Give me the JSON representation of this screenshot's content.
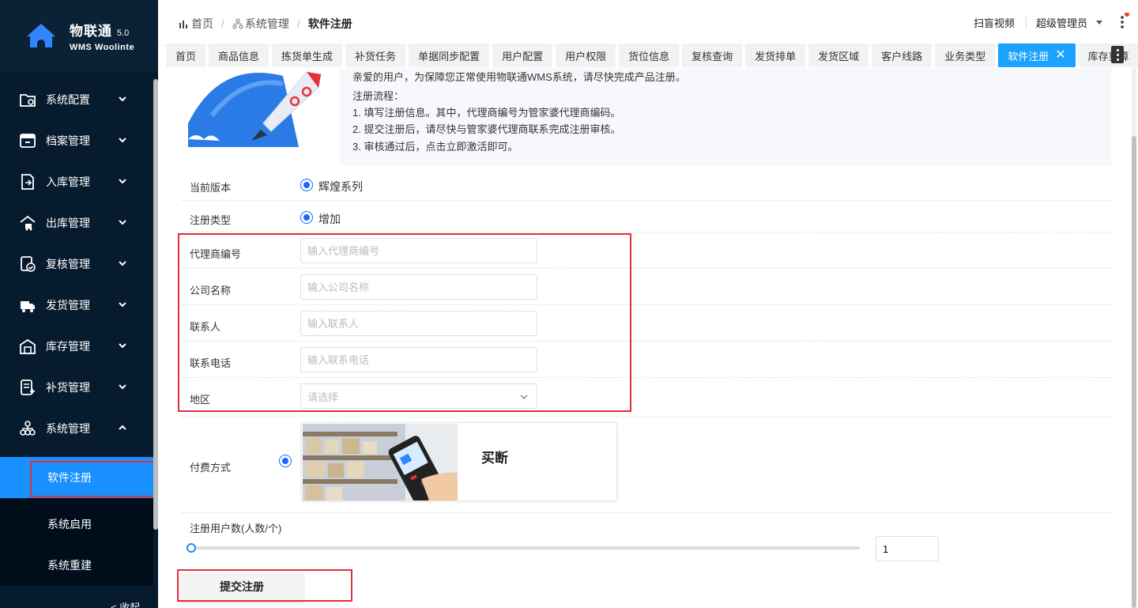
{
  "app": {
    "logo_cn": "物联通",
    "version": "5.0",
    "logo_en": "WMS Woolinte"
  },
  "sidebar": {
    "items": [
      {
        "label": "系统配置",
        "icon": "settings-folder-icon"
      },
      {
        "label": "档案管理",
        "icon": "archive-icon"
      },
      {
        "label": "入库管理",
        "icon": "inbound-icon"
      },
      {
        "label": "出库管理",
        "icon": "outbound-truck-icon"
      },
      {
        "label": "复核管理",
        "icon": "review-check-icon"
      },
      {
        "label": "发货管理",
        "icon": "shipping-icon"
      },
      {
        "label": "库存管理",
        "icon": "warehouse-icon"
      },
      {
        "label": "补货管理",
        "icon": "replenish-icon"
      },
      {
        "label": "系统管理",
        "icon": "org-tree-icon"
      }
    ],
    "subitems": [
      {
        "label": "软件注册"
      },
      {
        "label": "系统启用"
      },
      {
        "label": "系统重建"
      }
    ],
    "collapse_label": "< 收起"
  },
  "header": {
    "breadcrumb": [
      "首页",
      "系统管理",
      "软件注册"
    ],
    "scan_video": "扫盲视频",
    "user": "超级管理员"
  },
  "tabs": [
    "首页",
    "商品信息",
    "拣货单生成",
    "补货任务",
    "单据同步配置",
    "用户配置",
    "用户权限",
    "货位信息",
    "复核查询",
    "发货排单",
    "发货区域",
    "客户线路",
    "业务类型",
    "软件注册",
    "库存重算"
  ],
  "notice": {
    "line0": "亲爱的用户，为保障您正常使用物联通WMS系统，请尽快完成产品注册。",
    "title": "注册流程：",
    "step1": "1. 填写注册信息。其中，代理商编号为管家婆代理商编码。",
    "step2": "2. 提交注册后，请尽快与管家婆代理商联系完成注册审核。",
    "step3": "3. 审核通过后，点击立即激活即可。"
  },
  "form": {
    "version_label": "当前版本",
    "version_value": "辉煌系列",
    "type_label": "注册类型",
    "type_value": "增加",
    "agent_label": "代理商编号",
    "agent_placeholder": "输入代理商编号",
    "company_label": "公司名称",
    "company_placeholder": "输入公司名称",
    "contact_label": "联系人",
    "contact_placeholder": "输入联系人",
    "phone_label": "联系电话",
    "phone_placeholder": "输入联系电话",
    "region_label": "地区",
    "region_placeholder": "请选择",
    "pay_label": "付费方式",
    "pay_option": "买断",
    "users_label": "注册用户数(人数/个)",
    "users_value": "1",
    "submit": "提交注册"
  },
  "colors": {
    "sidebar_bg": "#071b2e",
    "accent": "#1890ff",
    "active_tab": "#1aa2ff",
    "highlight_box": "#e0303a"
  }
}
